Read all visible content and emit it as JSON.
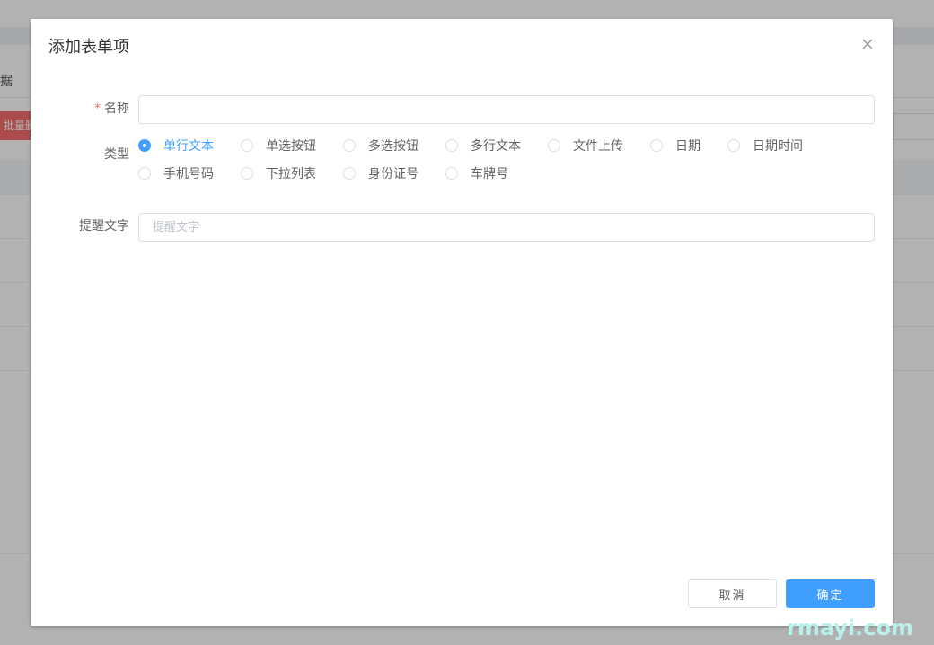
{
  "background": {
    "tab_text": "据",
    "batch_button": "批量删"
  },
  "dialog": {
    "title": "添加表单项",
    "close_icon": "close-icon",
    "fields": {
      "name": {
        "label": "名称",
        "required_mark": "*",
        "value": ""
      },
      "type": {
        "label": "类型",
        "selected": "单行文本",
        "options": [
          "单行文本",
          "单选按钮",
          "多选按钮",
          "多行文本",
          "文件上传",
          "日期",
          "日期时间",
          "手机号码",
          "下拉列表",
          "身份证号",
          "车牌号"
        ]
      },
      "hint": {
        "label": "提醒文字",
        "placeholder": "提醒文字",
        "value": ""
      }
    },
    "buttons": {
      "cancel": "取消",
      "confirm": "确定"
    }
  },
  "colors": {
    "primary": "#409eff",
    "danger": "#f56c6c",
    "overlay": "rgba(0,0,0,0.30)"
  },
  "watermark": "rmayi.com"
}
